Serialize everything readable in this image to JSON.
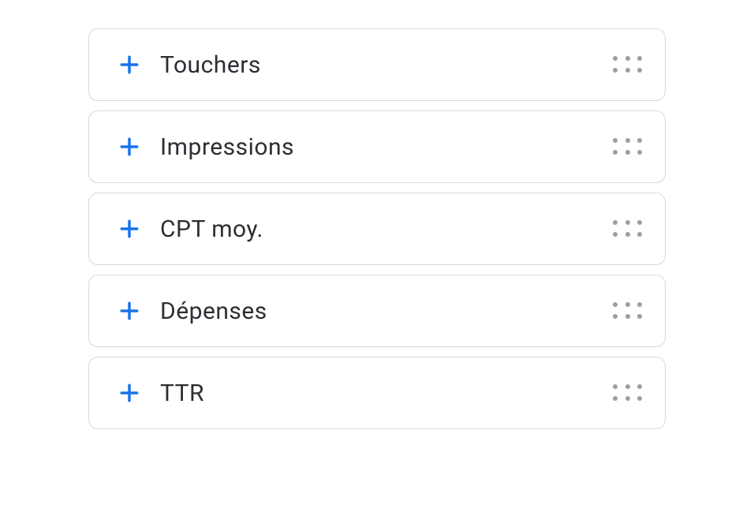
{
  "metrics": [
    {
      "label": "Touchers"
    },
    {
      "label": "Impressions"
    },
    {
      "label": "CPT moy."
    },
    {
      "label": "Dépenses"
    },
    {
      "label": "TTR"
    }
  ]
}
